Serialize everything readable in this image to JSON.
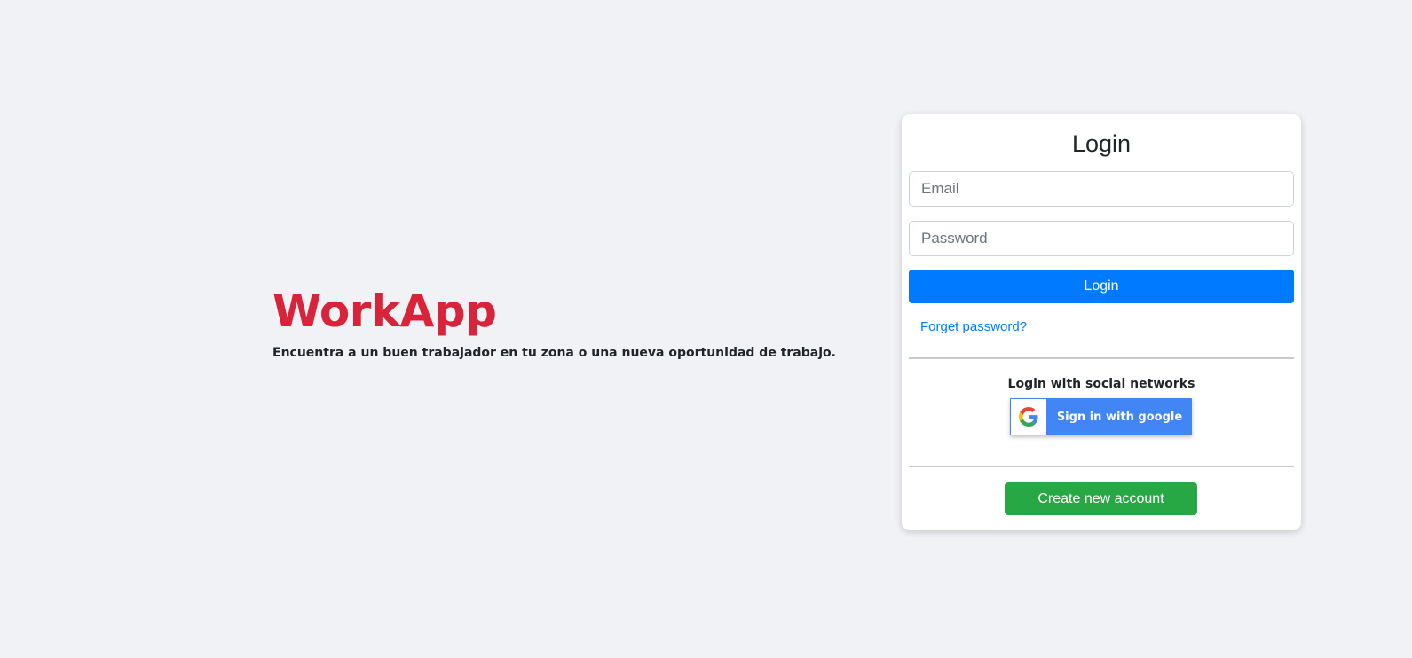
{
  "brand": {
    "title": "WorkApp",
    "tagline": "Encuentra a un buen trabajador en tu zona o una nueva oportunidad de trabajo.",
    "title_color": "#d9233a"
  },
  "login_card": {
    "title": "Login",
    "email": {
      "placeholder": "Email",
      "value": ""
    },
    "password": {
      "placeholder": "Password",
      "value": ""
    },
    "login_button_label": "Login",
    "forget_password_link": "Forget password?",
    "social_label": "Login with social networks",
    "google_button_label": "Sign in with google",
    "google_icon": "google-g-icon",
    "create_account_label": "Create new account"
  },
  "colors": {
    "background": "#f0f2f5",
    "primary": "#007bff",
    "success": "#28a745",
    "google_blue": "#4285f4"
  }
}
